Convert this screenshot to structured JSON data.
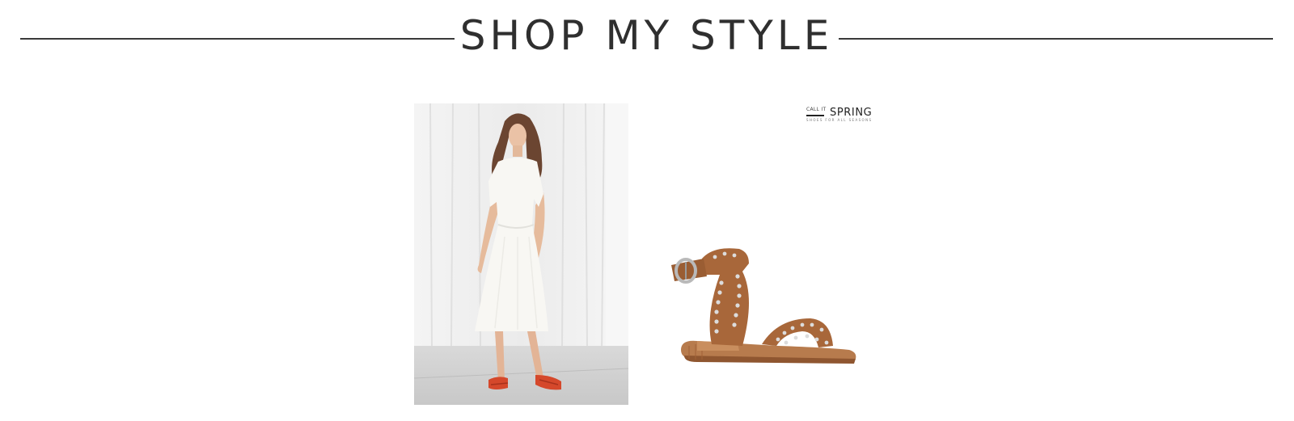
{
  "header": {
    "title": "SHOP MY STYLE"
  },
  "products": [
    {
      "name": "white midi dress",
      "image": "model-white-dress-photo"
    },
    {
      "name": "studded sandal",
      "image": "studded-tan-sandal-photo",
      "brand": {
        "prefix": "CALL IT",
        "name": "SPRING",
        "tagline": "SHOES FOR ALL SEASONS"
      }
    }
  ],
  "colors": {
    "title_text": "#2f2f2f",
    "rule": "#3a3a3a",
    "background": "#ffffff",
    "sandal_leather": "#a8673a",
    "sandal_accent": "#b9b9b9",
    "dress_backdrop": "#ececec",
    "dress_sandals": "#d5482b"
  }
}
